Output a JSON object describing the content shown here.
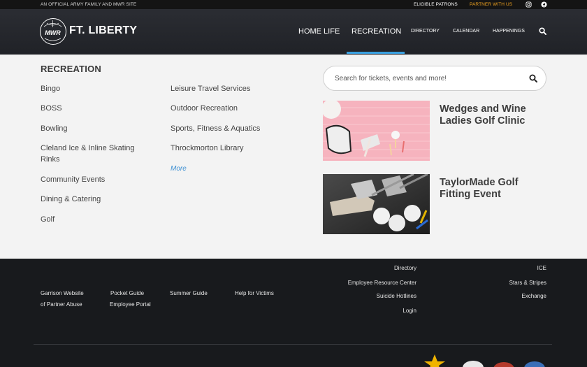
{
  "topbar": {
    "official": "AN OFFICIAL ARMY FAMILY AND MWR SITE",
    "eligible": "ELIGIBLE PATRONS",
    "partner": "PARTNER WITH US"
  },
  "header": {
    "logo_badge": "MWR",
    "logo_text": "FT. LIBERTY",
    "nav": {
      "home_life": "HOME LIFE",
      "recreation": "RECREATION",
      "directory": "DIRECTORY",
      "calendar": "CALENDAR",
      "happenings": "HAPPENINGS"
    }
  },
  "panel": {
    "title": "RECREATION",
    "col1": [
      "Bingo",
      "BOSS",
      "Bowling",
      "Cleland Ice & Inline Skating Rinks",
      "Community Events",
      "Dining & Catering",
      "Golf"
    ],
    "col2": [
      "Leisure Travel Services",
      "Outdoor Recreation",
      "Sports, Fitness & Aquatics",
      "Throckmorton Library"
    ],
    "more": "More",
    "search_placeholder": "Search for tickets, events and more!",
    "events": [
      {
        "title": "Wedges and Wine Ladies Golf Clinic"
      },
      {
        "title": "TaylorMade Golf Fitting Event"
      }
    ]
  },
  "footer": {
    "left": {
      "garrison": "Garrison Website",
      "pocket": "Pocket Guide",
      "summer": "Summer Guide",
      "help": "Help for Victims",
      "partner_abuse": "of Partner Abuse",
      "employee_portal": "Employee Portal"
    },
    "middle": [
      "Directory",
      "Employee Resource Center",
      "Suicide Hotlines",
      "Login"
    ],
    "right": [
      "ICE",
      "Stars & Stripes",
      "Exchange"
    ]
  },
  "colors": {
    "accent": "#3aa0e0",
    "partner": "#f1a31f",
    "header_bg": "#25272c",
    "footer_bg": "#181a1d",
    "star": "#f0b400"
  }
}
